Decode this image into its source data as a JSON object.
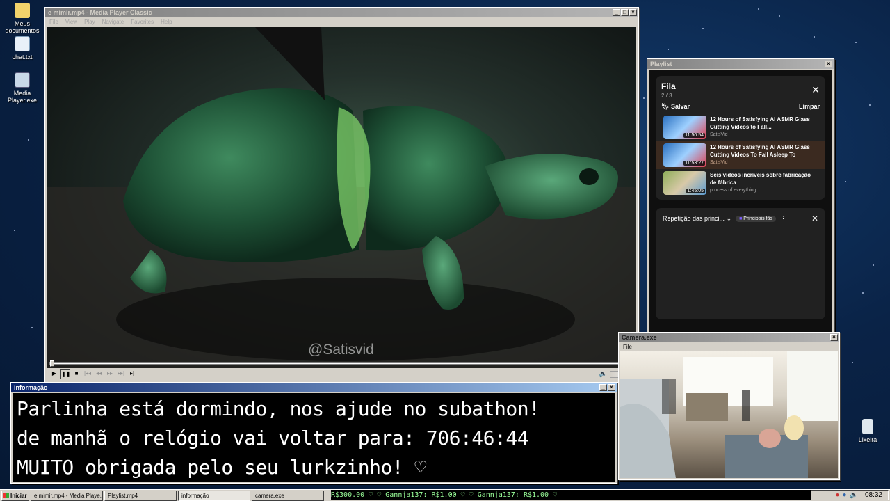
{
  "desktop": {
    "icons": [
      {
        "label": "Meus documentos"
      },
      {
        "label": "chat.txt"
      },
      {
        "label": "Media Player.exe"
      },
      {
        "label": "Lixeira"
      }
    ]
  },
  "mpc": {
    "title": "e mimir.mp4 - Media Player Classic",
    "menu": [
      "File",
      "View",
      "Play",
      "Navigate",
      "Favorites",
      "Help"
    ],
    "watermark": "@Satisvid"
  },
  "playlist": {
    "window_title": "Playlist",
    "queue_title": "Fila",
    "queue_count": "2 / 3",
    "save_label": "Salvar",
    "clear_label": "Limpar",
    "items": [
      {
        "title": "12 Hours of Satisfying AI ASMR Glass Cutting Videos to Fall...",
        "channel": "SatisVid",
        "duration": "11:50:54"
      },
      {
        "title": "12 Hours of Satisfying AI ASMR Glass Cutting Videos To Fall Asleep To",
        "channel": "SatisVid",
        "duration": "11:53:27"
      },
      {
        "title": "Seis vídeos incríveis sobre fabricação de fábrica",
        "channel": "process of everything",
        "duration": "1:45:05"
      }
    ],
    "chat_mode": "Repetição das princi...",
    "chat_badge": "Principais fãs"
  },
  "info": {
    "title": "informação",
    "lines": [
      "Parlinha está dormindo, nos ajude no subathon!",
      "de manhã o relógio vai voltar para:  706:46:44",
      "MUITO obrigada pelo seu lurkzinho! ♡"
    ]
  },
  "camera": {
    "title": "Camera.exe",
    "menu_file": "File"
  },
  "taskbar": {
    "start_label": "Iniciar",
    "tasks": [
      "e mimir.mp4 - Media Playe...",
      "Playlist.mp4",
      "informação",
      "camera.exe"
    ],
    "ticker": "R$300.00 ♡     ♡ Gannja137: R$1.00 ♡     ♡ Gannja137: R$1.00 ♡",
    "clock": "08:32"
  }
}
